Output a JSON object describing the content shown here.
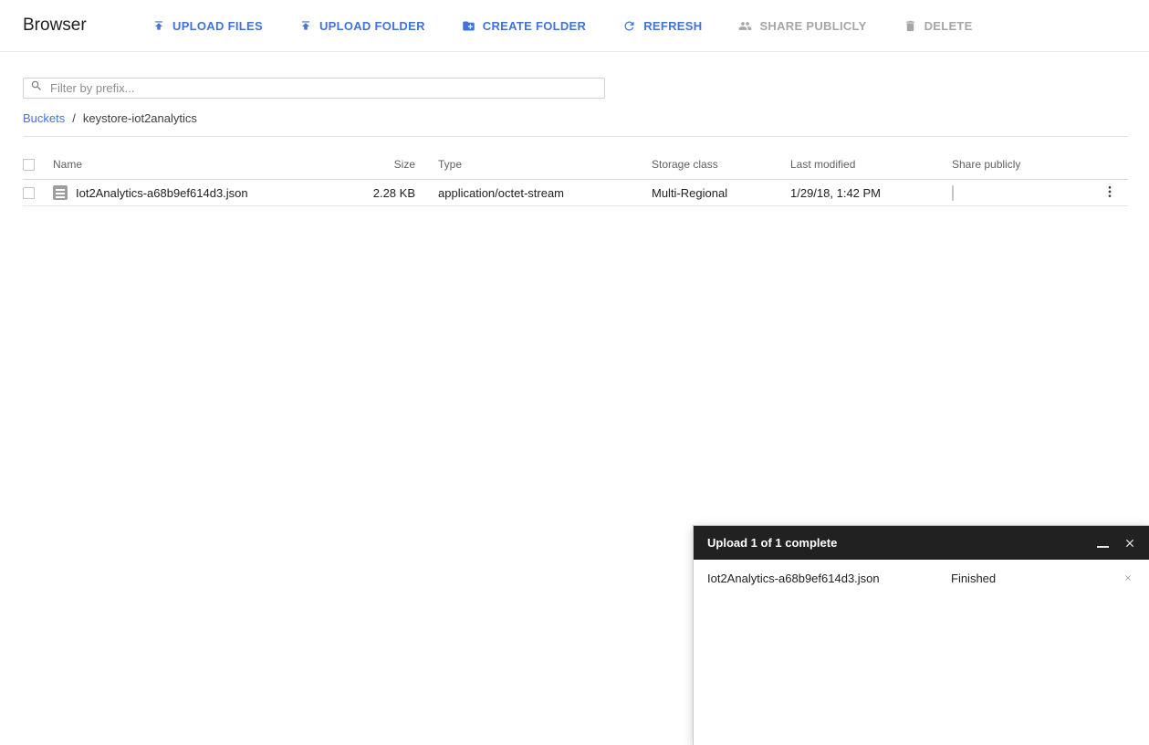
{
  "header": {
    "title": "Browser",
    "buttons": [
      {
        "label": "UPLOAD FILES",
        "icon": "upload-icon",
        "enabled": true
      },
      {
        "label": "UPLOAD FOLDER",
        "icon": "upload-icon",
        "enabled": true
      },
      {
        "label": "CREATE FOLDER",
        "icon": "create-folder-icon",
        "enabled": true
      },
      {
        "label": "REFRESH",
        "icon": "refresh-icon",
        "enabled": true
      },
      {
        "label": "SHARE PUBLICLY",
        "icon": "group-icon",
        "enabled": false
      },
      {
        "label": "DELETE",
        "icon": "delete-icon",
        "enabled": false
      }
    ]
  },
  "filter": {
    "placeholder": "Filter by prefix..."
  },
  "breadcrumb": {
    "root": "Buckets",
    "separator": "/",
    "current": "keystore-iot2analytics"
  },
  "table": {
    "columns": [
      "Name",
      "Size",
      "Type",
      "Storage class",
      "Last modified",
      "Share publicly"
    ],
    "rows": [
      {
        "name": "Iot2Analytics-a68b9ef614d3.json",
        "size": "2.28 KB",
        "type": "application/octet-stream",
        "storage_class": "Multi-Regional",
        "last_modified": "1/29/18, 1:42 PM",
        "shared_publicly": false
      }
    ]
  },
  "upload_dialog": {
    "title": "Upload 1 of 1 complete",
    "rows": [
      {
        "name": "Iot2Analytics-a68b9ef614d3.json",
        "status": "Finished"
      }
    ]
  },
  "colors": {
    "accent_blue": "#4273db",
    "disabled_gray": "#a6a6a6",
    "dialog_header_bg": "#212121",
    "row_text": "#212121",
    "table_header_text": "#616161"
  }
}
